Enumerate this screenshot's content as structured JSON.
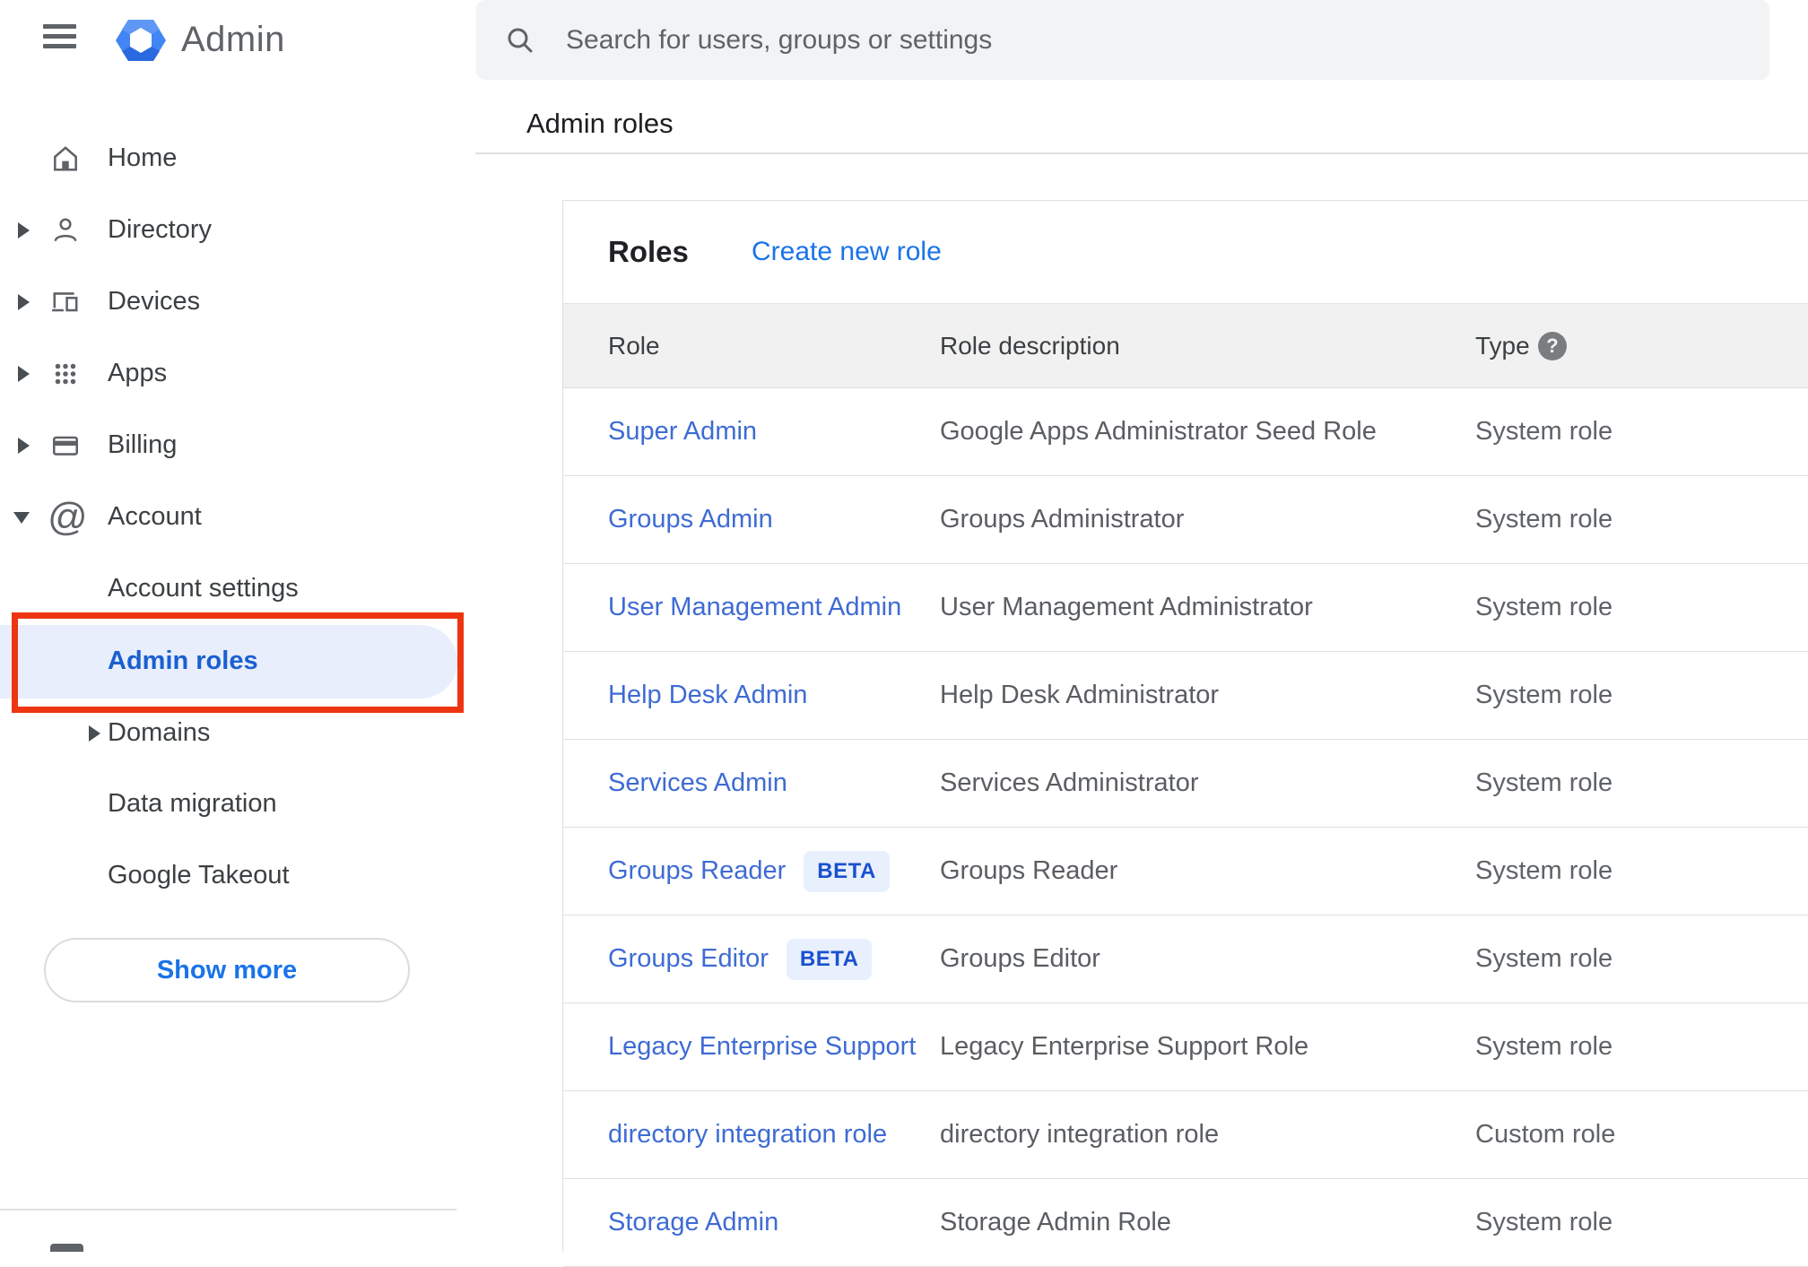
{
  "app": {
    "name": "Admin"
  },
  "search": {
    "placeholder": "Search for users, groups or settings"
  },
  "breadcrumb": "Admin roles",
  "sidebar": {
    "items": [
      {
        "label": "Home"
      },
      {
        "label": "Directory"
      },
      {
        "label": "Devices"
      },
      {
        "label": "Apps"
      },
      {
        "label": "Billing"
      },
      {
        "label": "Account"
      }
    ],
    "account_children": [
      {
        "label": "Account settings"
      },
      {
        "label": "Admin roles",
        "selected": true
      },
      {
        "label": "Domains"
      },
      {
        "label": "Data migration"
      },
      {
        "label": "Google Takeout"
      }
    ],
    "show_more_label": "Show more"
  },
  "main": {
    "title": "Roles",
    "create_link": "Create new role",
    "table": {
      "columns": [
        "Role",
        "Role description",
        "Type"
      ],
      "rows": [
        {
          "role": "Super Admin",
          "description": "Google Apps Administrator Seed Role",
          "type": "System role"
        },
        {
          "role": "Groups Admin",
          "description": "Groups Administrator",
          "type": "System role"
        },
        {
          "role": "User Management Admin",
          "description": "User Management Administrator",
          "type": "System role"
        },
        {
          "role": "Help Desk Admin",
          "description": "Help Desk Administrator",
          "type": "System role"
        },
        {
          "role": "Services Admin",
          "description": "Services Administrator",
          "type": "System role"
        },
        {
          "role": "Groups Reader",
          "badge": "BETA",
          "description": "Groups Reader",
          "type": "System role"
        },
        {
          "role": "Groups Editor",
          "badge": "BETA",
          "description": "Groups Editor",
          "type": "System role"
        },
        {
          "role": "Legacy Enterprise Support",
          "description": "Legacy Enterprise Support Role",
          "type": "System role"
        },
        {
          "role": "directory integration role",
          "description": "directory integration role",
          "type": "Custom role"
        },
        {
          "role": "Storage Admin",
          "description": "Storage Admin Role",
          "type": "System role"
        }
      ]
    }
  },
  "annotation": {
    "shape": "rectangle",
    "color": "#ed3512",
    "target": "Admin roles sidebar item"
  },
  "colors": {
    "accent_blue": "#1a73e8",
    "table_link_blue": "#3e6bd4",
    "selected_nav_blue": "#1a5fd0",
    "selected_nav_bg": "#e8eefc",
    "beta_badge_bg": "#e8f0fe",
    "beta_badge_text": "#1b51cf",
    "search_bar_bg": "#f1f3f4",
    "table_header_bg": "#f1f1f1",
    "icon_gray": "#5f6368",
    "annotation_red": "#ed3512"
  }
}
